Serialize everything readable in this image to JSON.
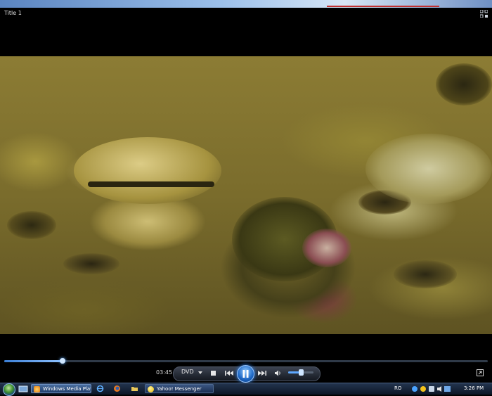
{
  "window": {
    "title": "Title 1"
  },
  "playback": {
    "elapsed": "03:45",
    "progress_fraction": 0.12,
    "state": "playing",
    "volume_fraction": 0.5,
    "source_label": "DVD"
  },
  "taskbar": {
    "tasks": [
      {
        "label": "Windows Media Player",
        "active": true
      },
      {
        "label": "Yahoo! Messenger",
        "active": false
      }
    ],
    "language": "RO",
    "clock": "3:26 PM"
  },
  "colors": {
    "accent": "#2e8bff",
    "background": "#000000"
  }
}
